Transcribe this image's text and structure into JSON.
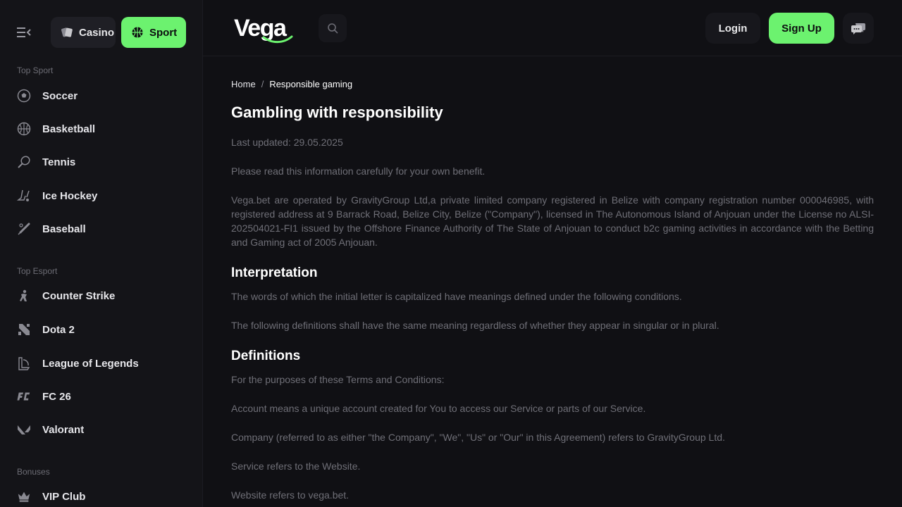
{
  "sidebar": {
    "casino_label": "Casino",
    "sport_label": "Sport",
    "top_sport_title": "Top Sport",
    "top_sport": [
      {
        "label": "Soccer",
        "icon": "soccer-ball-icon"
      },
      {
        "label": "Basketball",
        "icon": "basketball-icon"
      },
      {
        "label": "Tennis",
        "icon": "tennis-icon"
      },
      {
        "label": "Ice Hockey",
        "icon": "ice-hockey-icon"
      },
      {
        "label": "Baseball",
        "icon": "baseball-bat-icon"
      }
    ],
    "top_esport_title": "Top Esport",
    "top_esport": [
      {
        "label": "Counter Strike",
        "icon": "counter-strike-icon"
      },
      {
        "label": "Dota 2",
        "icon": "dota-icon"
      },
      {
        "label": "League of Legends",
        "icon": "league-of-legends-icon"
      },
      {
        "label": "FC 26",
        "icon": "fc-icon"
      },
      {
        "label": "Valorant",
        "icon": "valorant-icon"
      }
    ],
    "bonuses_title": "Bonuses",
    "bonuses": [
      {
        "label": "VIP Club",
        "icon": "crown-icon"
      }
    ]
  },
  "header": {
    "logo_text": "Vega",
    "login_label": "Login",
    "signup_label": "Sign Up"
  },
  "colors": {
    "accent": "#6cf26f",
    "background": "#101014",
    "sidebar": "#141418"
  },
  "breadcrumb": {
    "home": "Home",
    "separator": "/",
    "current": "Responsible gaming"
  },
  "content": {
    "title": "Gambling with responsibility",
    "last_updated": "Last updated: 29.05.2025",
    "intro": "Please read this information carefully for your own benefit.",
    "company_info": "Vega.bet are operated by GravityGroup Ltd,a private limited company registered in Belize with company registration number 000046985, with registered address at 9 Barrack Road, Belize City, Belize (\"Company\"), licensed in The Autonomous Island of Anjouan under the License no ALSI-202504021-FI1 issued by the Offshore Finance Authority of The State of Anjouan to conduct b2c gaming activities in accordance with the Betting and Gaming act of 2005 Anjouan.",
    "interpretation_title": "Interpretation",
    "interpretation_p1": "The words of which the initial letter is capitalized have meanings defined under the following conditions.",
    "interpretation_p2": "The following definitions shall have the same meaning regardless of whether they appear in singular or in plural.",
    "definitions_title": "Definitions",
    "definitions_p1": "For the purposes of these Terms and Conditions:",
    "definitions_p2": "Account means a unique account created for You to access our Service or parts of our Service.",
    "definitions_p3": "Company (referred to as either \"the Company\", \"We\", \"Us\" or \"Our\" in this Agreement) refers to GravityGroup Ltd.",
    "definitions_p4": "Service refers to the Website.",
    "definitions_p5": "Website refers to vega.bet."
  }
}
